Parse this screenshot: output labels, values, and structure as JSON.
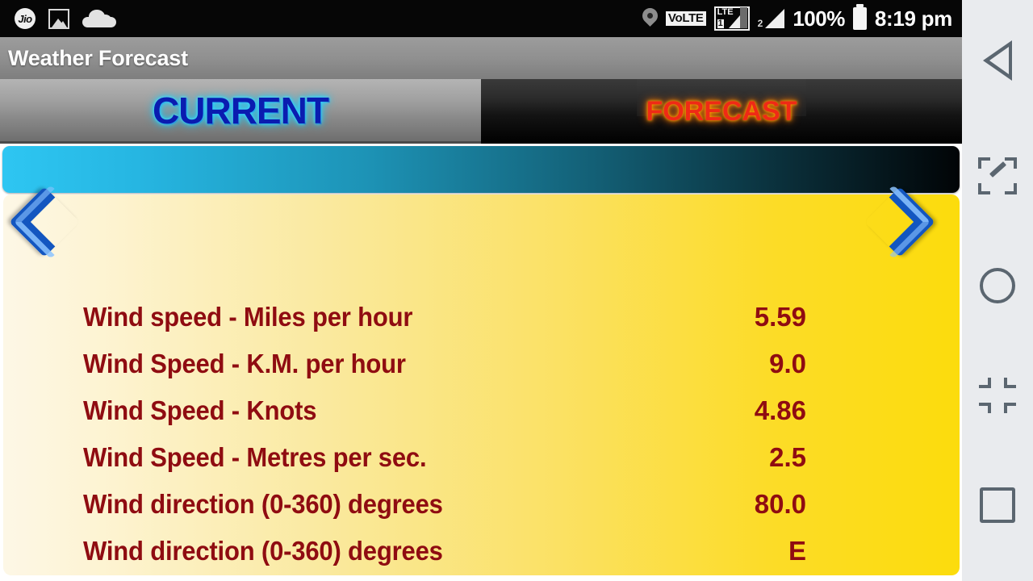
{
  "status_bar": {
    "carrier_label": "Jio",
    "icons_left": [
      "jio-logo",
      "gallery-icon",
      "cloud-icon"
    ],
    "location_icon": "location-pin-icon",
    "volte_label": "VoLTE",
    "sim1_network": "LTE",
    "sim1_number": "1",
    "sim2_number": "2",
    "battery_percent": "100%",
    "battery_icon": "battery-full-icon",
    "time": "8:19 pm"
  },
  "app": {
    "title": "Weather Forecast"
  },
  "tabs": [
    {
      "id": "current",
      "label": "CURRENT",
      "selected": true,
      "text_color": "#0a1cb0",
      "glow_color": "#23d4ff"
    },
    {
      "id": "forecast",
      "label": "FORECAST",
      "selected": false,
      "text_color": "#ef2a16",
      "glow_color": "#ff8a00"
    }
  ],
  "banner": {
    "text": "",
    "gradient_from": "#2ec6f2",
    "gradient_to": "#010406"
  },
  "card": {
    "prev_arrow_icon": "chevron-left-icon",
    "next_arrow_icon": "chevron-right-icon",
    "accent_background_from": "#fdf7e6",
    "accent_background_to": "#fcdc0c",
    "text_color": "#8f0c11",
    "rows": [
      {
        "label": "Wind speed - Miles per hour",
        "value": "5.59"
      },
      {
        "label": "Wind Speed - K.M. per hour",
        "value": "9.0"
      },
      {
        "label": "Wind Speed - Knots",
        "value": "4.86"
      },
      {
        "label": "Wind Speed - Metres per sec.",
        "value": "2.5"
      },
      {
        "label": "Wind direction (0-360) degrees",
        "value": "80.0"
      },
      {
        "label": "Wind direction (0-360) degrees",
        "value": "E"
      }
    ]
  },
  "nav_rail": {
    "items": [
      {
        "id": "back",
        "icon": "back-triangle-icon"
      },
      {
        "id": "screenshot",
        "icon": "screenshot-edit-icon"
      },
      {
        "id": "home",
        "icon": "home-circle-icon"
      },
      {
        "id": "minimize",
        "icon": "collapse-corners-icon"
      },
      {
        "id": "recents",
        "icon": "recents-square-icon"
      }
    ]
  }
}
